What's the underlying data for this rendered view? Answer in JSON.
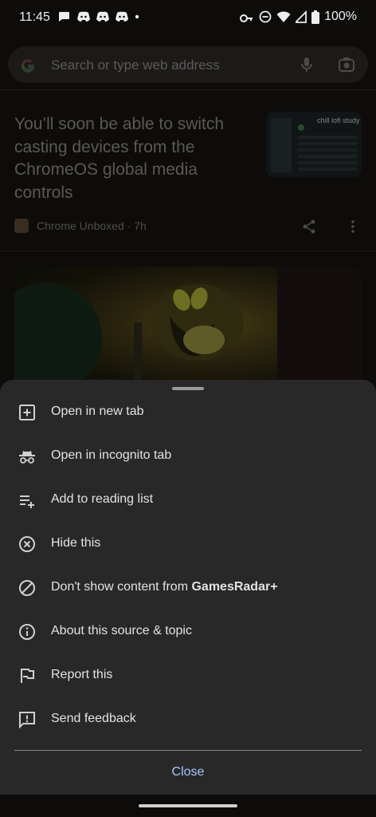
{
  "status_bar": {
    "time": "11:45",
    "battery": "100%"
  },
  "omnibox": {
    "placeholder": "Search or type web address"
  },
  "article": {
    "headline": "You’ll soon be able to switch casting devices from the ChromeOS global media controls",
    "source": "Chrome Unboxed · 7h",
    "thumbnail_text": "chill lofi study"
  },
  "menu": {
    "items": [
      {
        "icon": "open-new-tab-icon",
        "label": "Open in new tab"
      },
      {
        "icon": "incognito-icon",
        "label": "Open in incognito tab"
      },
      {
        "icon": "reading-list-add-icon",
        "label": "Add to reading list"
      },
      {
        "icon": "hide-icon",
        "label": "Hide this"
      },
      {
        "icon": "block-icon",
        "label": "Don't show content from ",
        "bold": "GamesRadar+"
      },
      {
        "icon": "info-icon",
        "label": "About this source & topic"
      },
      {
        "icon": "flag-icon",
        "label": "Report this"
      },
      {
        "icon": "feedback-icon",
        "label": "Send feedback"
      }
    ],
    "close_label": "Close"
  },
  "colors": {
    "accent": "#a8c7fa",
    "sheet": "#282828",
    "background": "#0d0c0b"
  }
}
